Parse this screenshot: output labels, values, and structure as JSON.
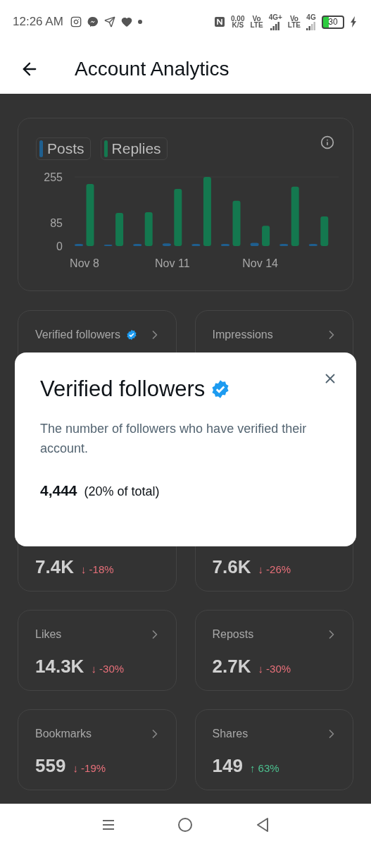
{
  "status_bar": {
    "time": "12:26 AM",
    "speed_value": "0.00",
    "speed_unit": "K/S",
    "sim_1": {
      "top": "Vo",
      "bottom": "LTE",
      "network": "4G+"
    },
    "sim_2": {
      "top": "Vo",
      "bottom": "LTE",
      "network": "4G"
    },
    "battery": "30"
  },
  "header": {
    "title": "Account Analytics"
  },
  "chart_card": {
    "chart_data": {
      "type": "bar",
      "categories": [
        "Nov 8",
        null,
        null,
        "Nov 11",
        null,
        null,
        "Nov 14",
        null,
        null
      ],
      "ylim": [
        0,
        255
      ],
      "yticks": [
        0,
        85,
        255
      ],
      "series": [
        {
          "name": "Posts",
          "color": "#1f5f8f",
          "values": [
            8,
            4,
            8,
            10,
            8,
            8,
            12,
            8,
            8
          ]
        },
        {
          "name": "Replies",
          "color": "#14784f",
          "values": [
            229,
            122,
            125,
            211,
            255,
            167,
            75,
            219,
            109
          ]
        }
      ]
    }
  },
  "metrics_top": [
    {
      "label": "Verified followers",
      "verified": true
    },
    {
      "label": "Impressions",
      "verified": false
    }
  ],
  "metrics_partial": [
    {
      "value": "7.4K",
      "change": "↓ -18%",
      "color": "#e8707a"
    },
    {
      "value": "7.6K",
      "change": "↓ -26%",
      "color": "#e8707a"
    }
  ],
  "metrics": [
    {
      "label": "Likes",
      "value": "14.3K",
      "change": "↓ -30%",
      "color": "#e8707a"
    },
    {
      "label": "Reposts",
      "value": "2.7K",
      "change": "↓ -30%",
      "color": "#e8707a"
    },
    {
      "label": "Bookmarks",
      "value": "559",
      "change": "↓ -19%",
      "color": "#e8707a"
    },
    {
      "label": "Shares",
      "value": "149",
      "change": "↑ 63%",
      "color": "#4cc08f"
    }
  ],
  "dialog": {
    "title": "Verified followers",
    "verified": true,
    "description": "The number of followers who have verified their account.",
    "count": "4,444",
    "share": "(20% of total)"
  }
}
